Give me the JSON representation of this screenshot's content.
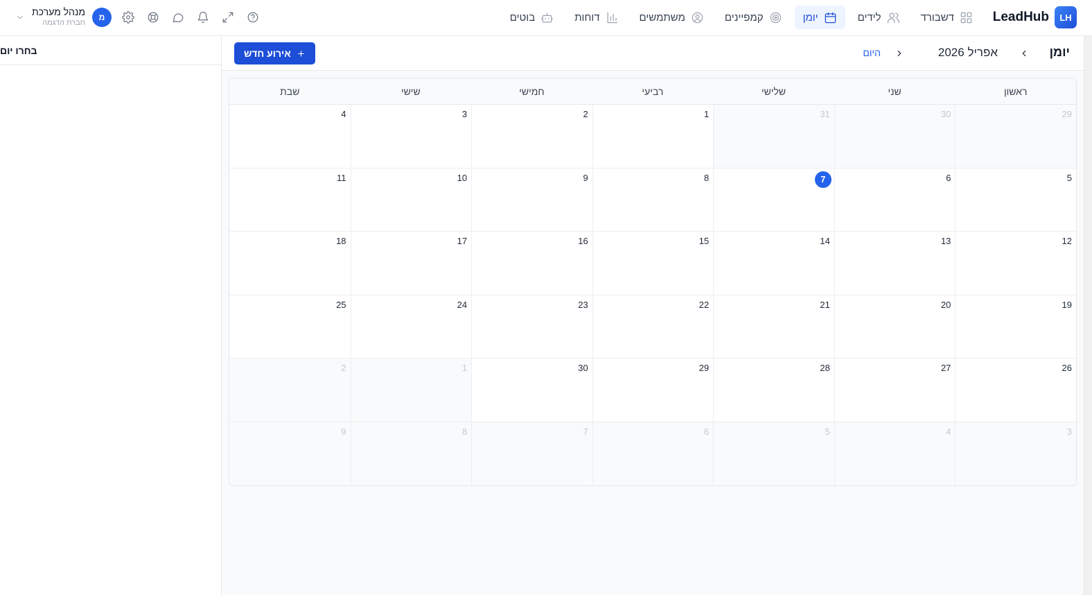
{
  "brand": {
    "badge": "LH",
    "name": "LeadHub"
  },
  "nav": [
    {
      "label": "דשבורד",
      "icon": "grid-icon",
      "active": false
    },
    {
      "label": "לידים",
      "icon": "users-icon",
      "active": false
    },
    {
      "label": "יומן",
      "icon": "calendar-icon",
      "active": true
    },
    {
      "label": "קמפיינים",
      "icon": "target-icon",
      "active": false
    },
    {
      "label": "משתמשים",
      "icon": "user-circle-icon",
      "active": false
    },
    {
      "label": "דוחות",
      "icon": "bar-chart-icon",
      "active": false
    },
    {
      "label": "בוטים",
      "icon": "bot-icon",
      "active": false
    }
  ],
  "user": {
    "name": "מנהל מערכת",
    "company": "חברת הדגמה",
    "initial": "מ"
  },
  "side_panel": {
    "title": "בחרו יום"
  },
  "calendar": {
    "title": "יומן",
    "month_label": "אפריל 2026",
    "today_label": "היום",
    "new_event_label": "אירוע חדש",
    "weekdays": [
      "ראשון",
      "שני",
      "שלישי",
      "רביעי",
      "חמישי",
      "שישי",
      "שבת"
    ],
    "weeks": [
      [
        {
          "n": "29",
          "out": true
        },
        {
          "n": "30",
          "out": true
        },
        {
          "n": "31",
          "out": true
        },
        {
          "n": "1"
        },
        {
          "n": "2"
        },
        {
          "n": "3"
        },
        {
          "n": "4"
        }
      ],
      [
        {
          "n": "5"
        },
        {
          "n": "6"
        },
        {
          "n": "7",
          "today": true
        },
        {
          "n": "8"
        },
        {
          "n": "9"
        },
        {
          "n": "10"
        },
        {
          "n": "11"
        }
      ],
      [
        {
          "n": "12"
        },
        {
          "n": "13"
        },
        {
          "n": "14"
        },
        {
          "n": "15"
        },
        {
          "n": "16"
        },
        {
          "n": "17"
        },
        {
          "n": "18"
        }
      ],
      [
        {
          "n": "19"
        },
        {
          "n": "20"
        },
        {
          "n": "21"
        },
        {
          "n": "22"
        },
        {
          "n": "23"
        },
        {
          "n": "24"
        },
        {
          "n": "25"
        }
      ],
      [
        {
          "n": "26"
        },
        {
          "n": "27"
        },
        {
          "n": "28"
        },
        {
          "n": "29"
        },
        {
          "n": "30"
        },
        {
          "n": "1",
          "out": true
        },
        {
          "n": "2",
          "out": true
        }
      ],
      [
        {
          "n": "3",
          "out": true
        },
        {
          "n": "4",
          "out": true
        },
        {
          "n": "5",
          "out": true
        },
        {
          "n": "6",
          "out": true
        },
        {
          "n": "7",
          "out": true
        },
        {
          "n": "8",
          "out": true
        },
        {
          "n": "9",
          "out": true
        }
      ]
    ]
  },
  "colors": {
    "accent": "#1d4ed8",
    "today": "#2563eb"
  }
}
